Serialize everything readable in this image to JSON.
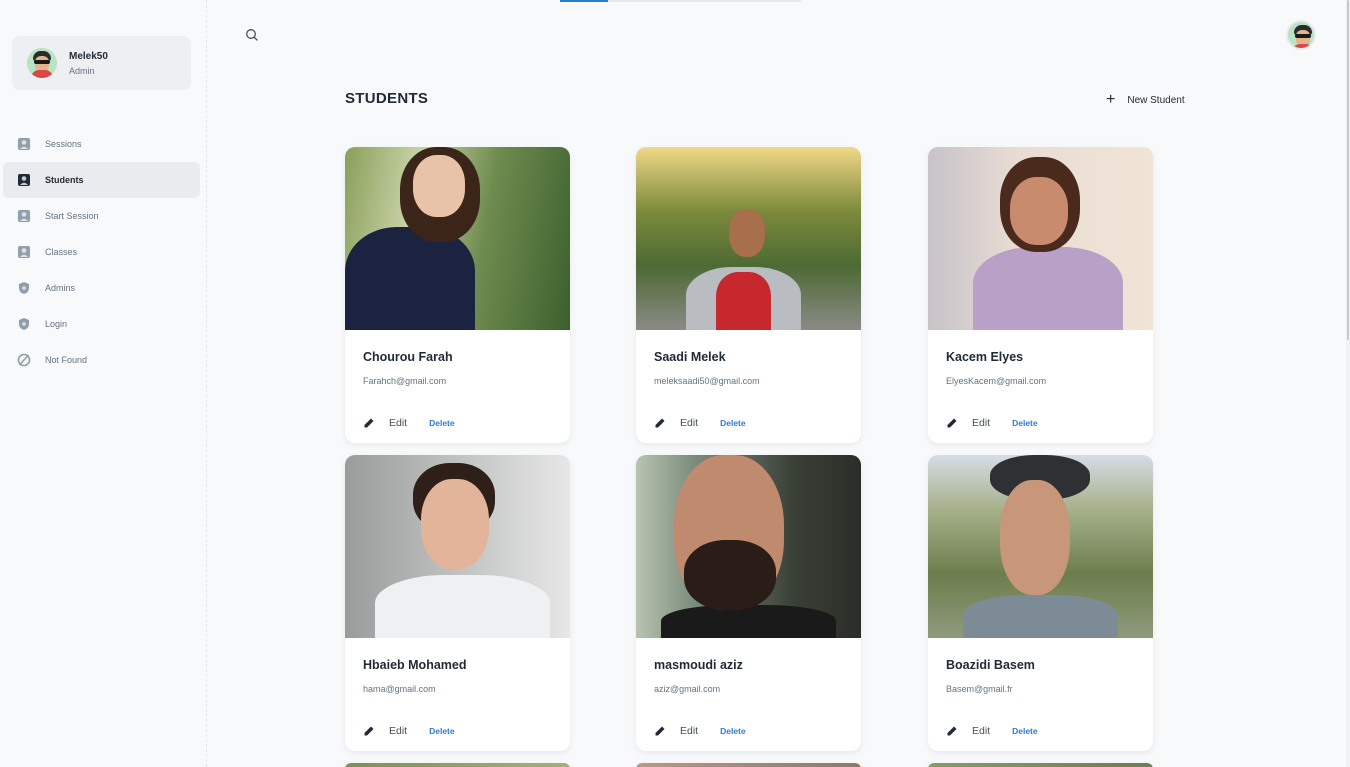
{
  "account": {
    "name": "Melek50",
    "role": "Admin"
  },
  "nav": [
    {
      "label": "Sessions",
      "icon": "user-icon",
      "active": false
    },
    {
      "label": "Students",
      "icon": "user-icon",
      "active": true
    },
    {
      "label": "Start Session",
      "icon": "user-icon",
      "active": false
    },
    {
      "label": "Classes",
      "icon": "user-icon",
      "active": false
    },
    {
      "label": "Admins",
      "icon": "lock-icon",
      "active": false
    },
    {
      "label": "Login",
      "icon": "lock-icon",
      "active": false
    },
    {
      "label": "Not Found",
      "icon": "slash-circle-icon",
      "active": false
    }
  ],
  "page": {
    "title": "STUDENTS",
    "new_button": "New Student"
  },
  "colors": {
    "accent": "#2d7dd2",
    "text": "#212b36",
    "muted": "#637381"
  },
  "students": [
    {
      "name": "Chourou Farah",
      "email": "Farahch@gmail.com",
      "edit": "Edit",
      "delete": "Delete"
    },
    {
      "name": "Saadi Melek",
      "email": "meleksaadi50@gmail.com",
      "edit": "Edit",
      "delete": "Delete"
    },
    {
      "name": "Kacem Elyes",
      "email": "ElyesKacem@gmail.com",
      "edit": "Edit",
      "delete": "Delete"
    },
    {
      "name": "Hbaieb Mohamed",
      "email": "hama@gmail.com",
      "edit": "Edit",
      "delete": "Delete"
    },
    {
      "name": "masmoudi aziz",
      "email": "aziz@gmail.com",
      "edit": "Edit",
      "delete": "Delete"
    },
    {
      "name": "Boazidi Basem",
      "email": "Basem@gmail.fr",
      "edit": "Edit",
      "delete": "Delete"
    }
  ]
}
